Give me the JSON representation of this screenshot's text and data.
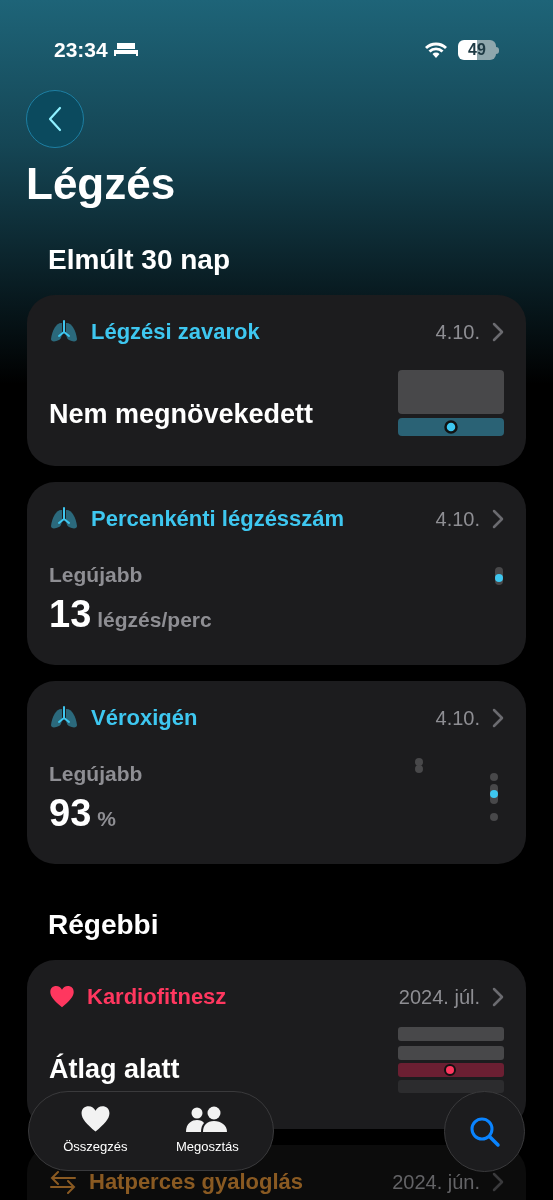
{
  "status_bar": {
    "time": "23:34",
    "battery": "49"
  },
  "page_title": "Légzés",
  "sections": [
    {
      "title": "Elmúlt 30 nap",
      "cards": [
        {
          "kind": "level",
          "title": "Légzési zavarok",
          "date": "4.10.",
          "color": "#3ec7f0",
          "value": "Nem megnövekedett"
        },
        {
          "kind": "latest",
          "title": "Percenkénti légzésszám",
          "date": "4.10.",
          "color": "#3ec7f0",
          "label": "Legújabb",
          "value": "13",
          "unit": "légzés/perc"
        },
        {
          "kind": "spread",
          "title": "Véroxigén",
          "date": "4.10.",
          "color": "#3ec7f0",
          "label": "Legújabb",
          "value": "93",
          "unit": "%"
        }
      ]
    },
    {
      "title": "Régebbi",
      "cards": [
        {
          "kind": "rating",
          "title": "Kardiofitnesz",
          "date": "2024. júl.",
          "color": "#ff375f",
          "value": "Átlag alatt"
        },
        {
          "kind": "walk",
          "title": "Hatperces gyaloglás",
          "date": "2024. jún.",
          "color": "#8a5a22"
        }
      ]
    }
  ],
  "tab_bar": {
    "items": [
      {
        "label": "Összegzés",
        "kind": "heart"
      },
      {
        "label": "Megosztás",
        "kind": "people"
      }
    ]
  }
}
